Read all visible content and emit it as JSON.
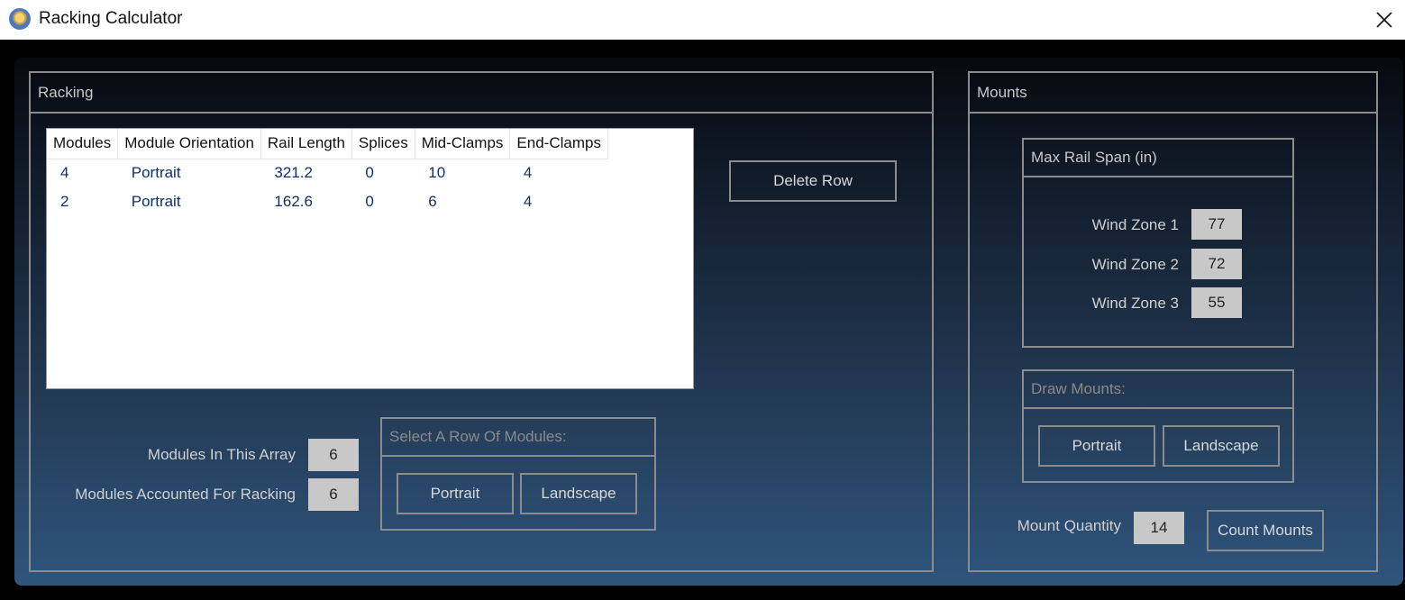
{
  "window": {
    "title": "Racking Calculator"
  },
  "racking": {
    "header": "Racking",
    "table": {
      "columns": [
        "Modules",
        "Module Orientation",
        "Rail Length",
        "Splices",
        "Mid-Clamps",
        "End-Clamps"
      ],
      "rows": [
        [
          "4",
          "Portrait",
          "321.2",
          "0",
          "10",
          "4"
        ],
        [
          "2",
          "Portrait",
          "162.6",
          "0",
          "6",
          "4"
        ]
      ]
    },
    "delete_row_label": "Delete Row",
    "modules_in_array_label": "Modules In This Array",
    "modules_in_array_value": "6",
    "modules_accounted_label": "Modules Accounted For Racking",
    "modules_accounted_value": "6",
    "select_row": {
      "header": "Select A Row Of Modules:",
      "portrait_label": "Portrait",
      "landscape_label": "Landscape"
    }
  },
  "mounts": {
    "header": "Mounts",
    "max_rail_span": {
      "header": "Max Rail Span (in)",
      "zones": [
        {
          "label": "Wind Zone 1",
          "value": "77"
        },
        {
          "label": "Wind Zone 2",
          "value": "72"
        },
        {
          "label": "Wind Zone 3",
          "value": "55"
        }
      ]
    },
    "draw_mounts": {
      "header": "Draw Mounts:",
      "portrait_label": "Portrait",
      "landscape_label": "Landscape"
    },
    "mount_quantity_label": "Mount Quantity",
    "mount_quantity_value": "14",
    "count_mounts_label": "Count Mounts"
  },
  "icons": {
    "app": "app-bulb-icon",
    "close": "close-icon"
  }
}
